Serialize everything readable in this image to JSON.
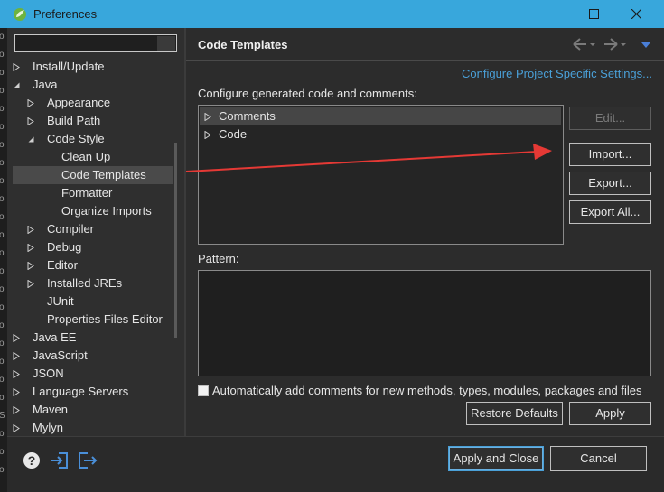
{
  "window": {
    "title": "Preferences",
    "icon": "eclipse-spring-icon",
    "controls": [
      "minimize-icon",
      "maximize-icon",
      "close-icon"
    ]
  },
  "left_edge_glyphs": [
    "o",
    "o",
    "o",
    "o",
    "o",
    "o",
    "o",
    "o",
    "o",
    "o",
    "o",
    "o",
    "o",
    "o",
    "o",
    "o",
    "o",
    "o",
    "o",
    "o",
    "o",
    "S",
    "o",
    "o",
    "o"
  ],
  "filter": {
    "value": "",
    "placeholder": ""
  },
  "tree": [
    {
      "label": "Install/Update",
      "level": 0,
      "twisty": "collapsed"
    },
    {
      "label": "Java",
      "level": 0,
      "twisty": "expanded"
    },
    {
      "label": "Appearance",
      "level": 1,
      "twisty": "collapsed"
    },
    {
      "label": "Build Path",
      "level": 1,
      "twisty": "collapsed"
    },
    {
      "label": "Code Style",
      "level": 1,
      "twisty": "expanded"
    },
    {
      "label": "Clean Up",
      "level": 2,
      "twisty": "none"
    },
    {
      "label": "Code Templates",
      "level": 2,
      "twisty": "none",
      "selected": true
    },
    {
      "label": "Formatter",
      "level": 2,
      "twisty": "none"
    },
    {
      "label": "Organize Imports",
      "level": 2,
      "twisty": "none"
    },
    {
      "label": "Compiler",
      "level": 1,
      "twisty": "collapsed"
    },
    {
      "label": "Debug",
      "level": 1,
      "twisty": "collapsed"
    },
    {
      "label": "Editor",
      "level": 1,
      "twisty": "collapsed"
    },
    {
      "label": "Installed JREs",
      "level": 1,
      "twisty": "collapsed"
    },
    {
      "label": "JUnit",
      "level": 1,
      "twisty": "none"
    },
    {
      "label": "Properties Files Editor",
      "level": 1,
      "twisty": "none"
    },
    {
      "label": "Java EE",
      "level": 0,
      "twisty": "collapsed"
    },
    {
      "label": "JavaScript",
      "level": 0,
      "twisty": "collapsed"
    },
    {
      "label": "JSON",
      "level": 0,
      "twisty": "collapsed"
    },
    {
      "label": "Language Servers",
      "level": 0,
      "twisty": "collapsed"
    },
    {
      "label": "Maven",
      "level": 0,
      "twisty": "collapsed"
    },
    {
      "label": "Mylyn",
      "level": 0,
      "twisty": "collapsed"
    }
  ],
  "page": {
    "title": "Code Templates",
    "config_link": "Configure Project Specific Settings...",
    "configure_label": "Configure generated code and comments:",
    "templates": [
      {
        "label": "Comments",
        "selected": true
      },
      {
        "label": "Code",
        "selected": false
      }
    ],
    "buttons": {
      "edit": "Edit...",
      "import": "Import...",
      "export": "Export...",
      "export_all": "Export All..."
    },
    "pattern_label": "Pattern:",
    "pattern_value": "",
    "auto_comments": {
      "label": "Automatically add comments for new methods, types, modules, packages and files",
      "checked": false
    },
    "restore_defaults": "Restore Defaults",
    "apply": "Apply"
  },
  "footer": {
    "icons": [
      "help-icon",
      "import-preferences-icon",
      "export-preferences-icon"
    ],
    "apply_and_close": "Apply and Close",
    "cancel": "Cancel"
  },
  "colors": {
    "titlebar": "#38a7dc",
    "link": "#4aa0d8",
    "annotation_arrow": "#e53935",
    "footer_icons": "#4a8fd8"
  }
}
